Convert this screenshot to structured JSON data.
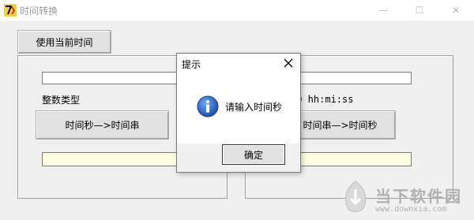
{
  "window": {
    "title": "时间转换",
    "controls": {
      "minimize": "—",
      "maximize": "☐",
      "close": "✕"
    }
  },
  "main": {
    "current_time_button": "使用当前时间",
    "left_group": {
      "int_type_label": "整数类型",
      "convert_button": "时间秒—>时间串",
      "top_field_value": "",
      "bottom_field_value": ""
    },
    "right_group": {
      "format_label": "DD hh:mi:ss",
      "convert_button": "时间串—>时间秒",
      "top_field_value": "",
      "bottom_field_value": ""
    }
  },
  "dialog": {
    "title": "提示",
    "message": "请输入时间秒",
    "ok_button": "确定",
    "icon": "info-icon"
  },
  "watermark": {
    "brand": "当下软件园",
    "url": "www.downxia.com"
  },
  "colors": {
    "yellow_field": "#ffffe1",
    "info_icon": "#1f5fbf"
  }
}
